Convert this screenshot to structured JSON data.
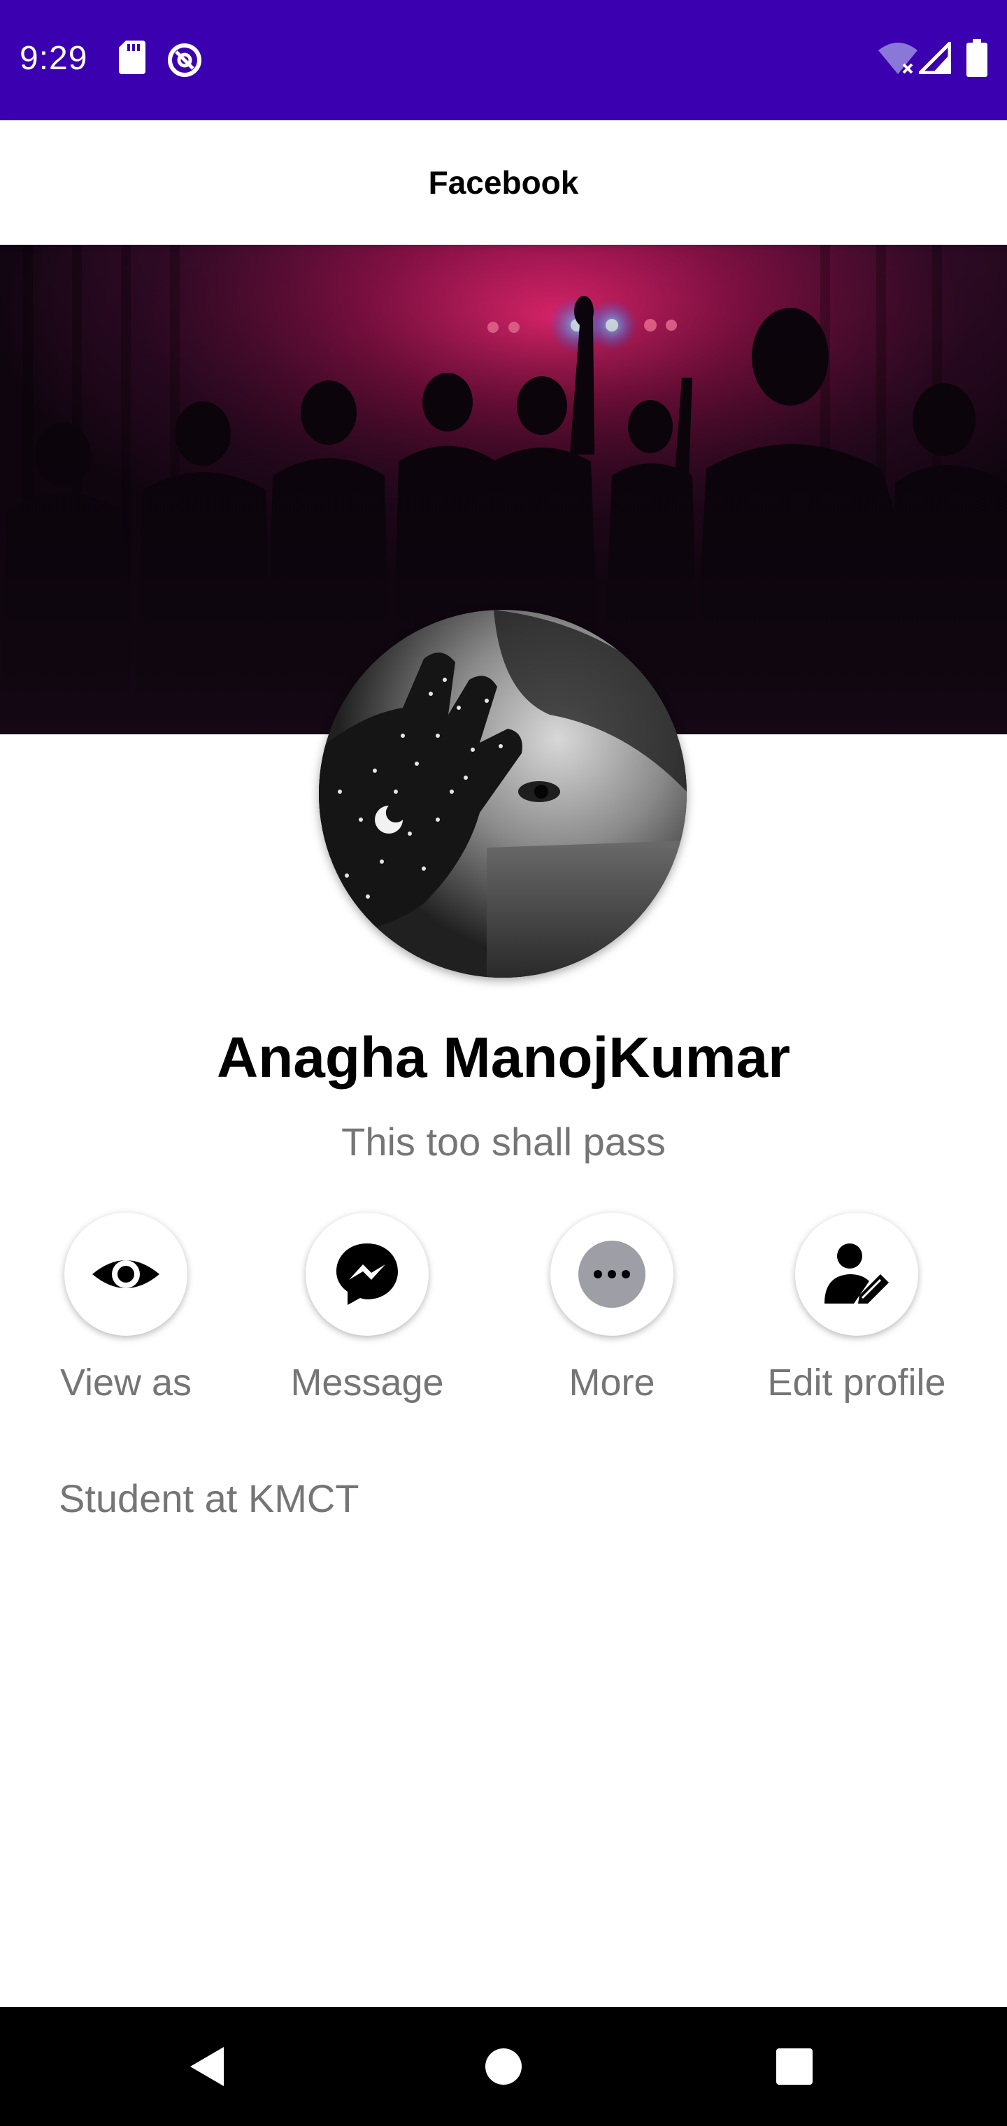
{
  "status_bar": {
    "time": "9:29",
    "background": "#3b00b0",
    "left_icons": [
      "sd-card-icon",
      "sync-off-icon"
    ],
    "right_icons": [
      "wifi-off-icon",
      "cell-signal-icon",
      "battery-icon"
    ]
  },
  "app_bar": {
    "title": "Facebook"
  },
  "profile": {
    "name": "Anagha ManojKumar",
    "bio": "This too shall pass",
    "work": "Student at KMCT"
  },
  "actions": [
    {
      "label": "View as",
      "icon": "eye-icon"
    },
    {
      "label": "Message",
      "icon": "messenger-icon"
    },
    {
      "label": "More",
      "icon": "more-dots-icon"
    },
    {
      "label": "Edit profile",
      "icon": "edit-person-icon"
    }
  ],
  "nav_bar": {
    "buttons": [
      "back-icon",
      "home-icon",
      "recents-icon"
    ]
  }
}
